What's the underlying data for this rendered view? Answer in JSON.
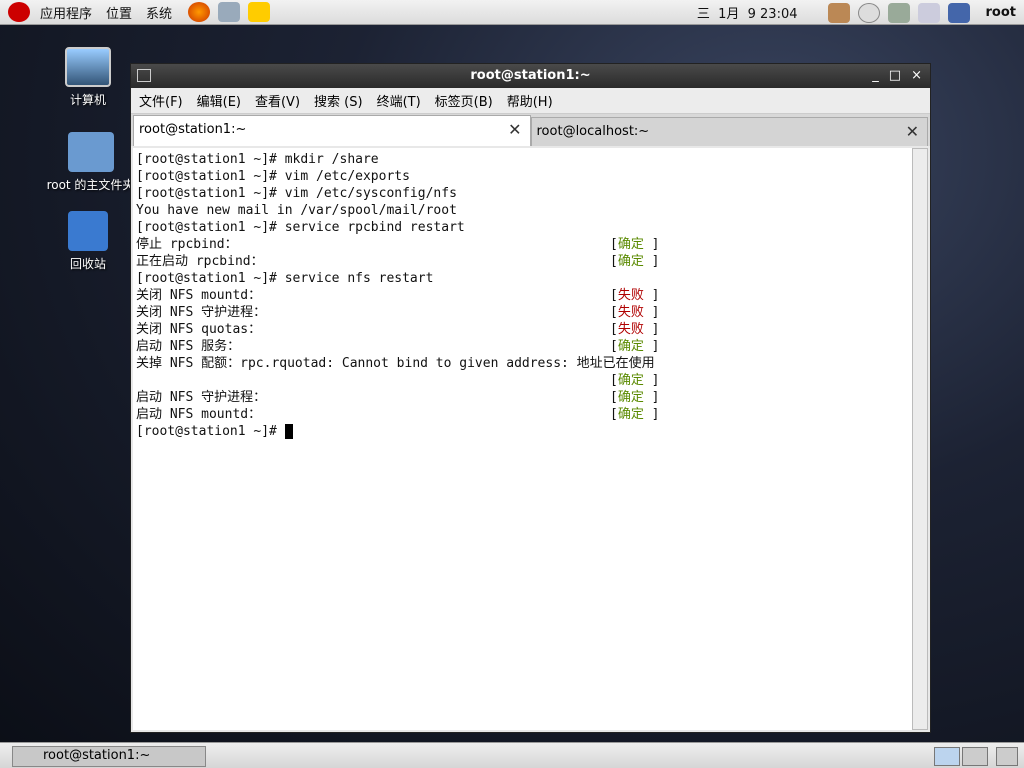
{
  "top_panel": {
    "menus": [
      "应用程序",
      "位置",
      "系统"
    ],
    "clock": "三  1月  9 23:04",
    "user": "root"
  },
  "desktop": {
    "icons": [
      "计算机",
      "root 的主文件夹",
      "回收站"
    ]
  },
  "window": {
    "title": "root@station1:~",
    "controls": [
      "_",
      "□",
      "×"
    ],
    "menu": [
      "文件(F)",
      "编辑(E)",
      "查看(V)",
      "搜索 (S)",
      "终端(T)",
      "标签页(B)",
      "帮助(H)"
    ],
    "tabs": [
      {
        "label": "root@station1:~"
      },
      {
        "label": "root@localhost:~"
      }
    ],
    "lines": [
      {
        "text": "[root@station1 ~]# mkdir /share"
      },
      {
        "text": "[root@station1 ~]# vim /etc/exports"
      },
      {
        "text": "[root@station1 ~]# vim /etc/sysconfig/nfs"
      },
      {
        "text": "You have new mail in /var/spool/mail/root"
      },
      {
        "text": "[root@station1 ~]# service rpcbind restart"
      },
      {
        "text": "停止 rpcbind：",
        "status": "确定",
        "kind": "ok"
      },
      {
        "text": "正在启动 rpcbind：",
        "status": "确定",
        "kind": "ok"
      },
      {
        "text": "[root@station1 ~]# service nfs restart"
      },
      {
        "text": "关闭 NFS mountd：",
        "status": "失败",
        "kind": "fail"
      },
      {
        "text": "关闭 NFS 守护进程：",
        "status": "失败",
        "kind": "fail"
      },
      {
        "text": "关闭 NFS quotas：",
        "status": "失败",
        "kind": "fail"
      },
      {
        "text": "启动 NFS 服务：",
        "status": "确定",
        "kind": "ok"
      },
      {
        "text": "关掉 NFS 配额：rpc.rquotad: Cannot bind to given address: 地址已在使用"
      },
      {
        "text": "",
        "status": "确定",
        "kind": "ok"
      },
      {
        "text": "启动 NFS 守护进程：",
        "status": "确定",
        "kind": "ok"
      },
      {
        "text": "启动 NFS mountd：",
        "status": "确定",
        "kind": "ok"
      },
      {
        "text": "[root@station1 ~]# "
      }
    ]
  },
  "taskbar": {
    "item": "root@station1:~"
  }
}
